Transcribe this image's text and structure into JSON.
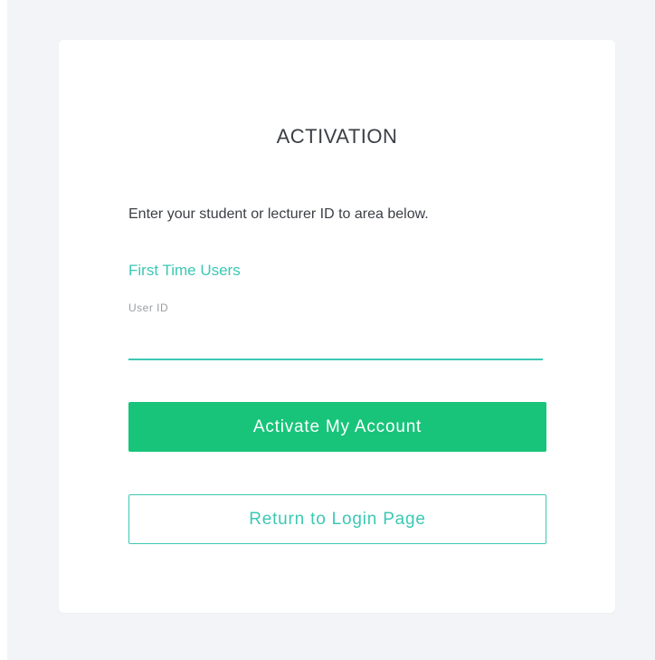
{
  "activation": {
    "title": "ACTIVATION",
    "instruction": "Enter your student or lecturer ID to area below.",
    "section_label": "First Time Users",
    "user_id_label": "User ID",
    "user_id_value": "",
    "activate_label": "Activate My Account",
    "return_label": "Return to Login Page"
  },
  "colors": {
    "page_background": "#f3f4f8",
    "card_background": "#ffffff",
    "accent": "#3cc8b4",
    "primary_button": "#17c47a",
    "text": "#3b3f45",
    "muted": "#9a9ea4"
  }
}
